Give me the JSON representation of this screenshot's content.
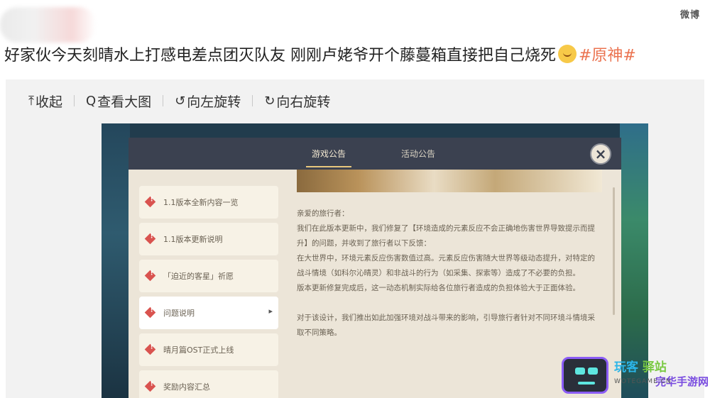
{
  "post": {
    "text": "好家伙今天刻晴水上打感电差点团灭队友 刚刚卢姥爷开个藤蔓箱直接把自己烧死",
    "hashtag": "#原神#"
  },
  "top_logo": "微博",
  "toolbar": {
    "collapse": "收起",
    "view_large": "查看大图",
    "rotate_left": "向左旋转",
    "rotate_right": "向右旋转"
  },
  "announcement": {
    "tabs": [
      {
        "label": "游戏公告",
        "active": true
      },
      {
        "label": "活动公告",
        "active": false
      }
    ],
    "close_glyph": "×",
    "list": [
      {
        "label": "1.1版本全新内容一览",
        "active": false
      },
      {
        "label": "1.1版本更新说明",
        "active": false
      },
      {
        "label": "「迫近的客星」祈愿",
        "active": false
      },
      {
        "label": "问题说明",
        "active": true
      },
      {
        "label": "晴月篇OST正式上线",
        "active": false
      },
      {
        "label": "奖励内容汇总",
        "active": false
      }
    ],
    "body": [
      "亲爱的旅行者：",
      "我们在此版本更新中，我们修复了【环境造成的元素反应不会正确地伤害世界导致提示而提升】的问题，并收到了旅行者以下反馈：",
      "在大世界中，环境元素反应伤害数值过高。元素反应伤害随大世界等级动态提升，对特定的战斗情境（如科尔沁晴灵）和非战斗的行为（如采集、探索等）造成了不必要的负担。",
      "版本更新修复完成后，这一动态机制实际给各位旅行者造成的负担体验大于正面体验。",
      "",
      "对于该设计，我们推出如此加强环境对战斗带来的影响，引导旅行者针对不同环境斗情境采取不同策略。"
    ]
  },
  "watermark": {
    "title_a": "玩客",
    "title_b": "驿站",
    "sub": "完华手游网",
    "domain": "WOTEGAME.CN"
  }
}
